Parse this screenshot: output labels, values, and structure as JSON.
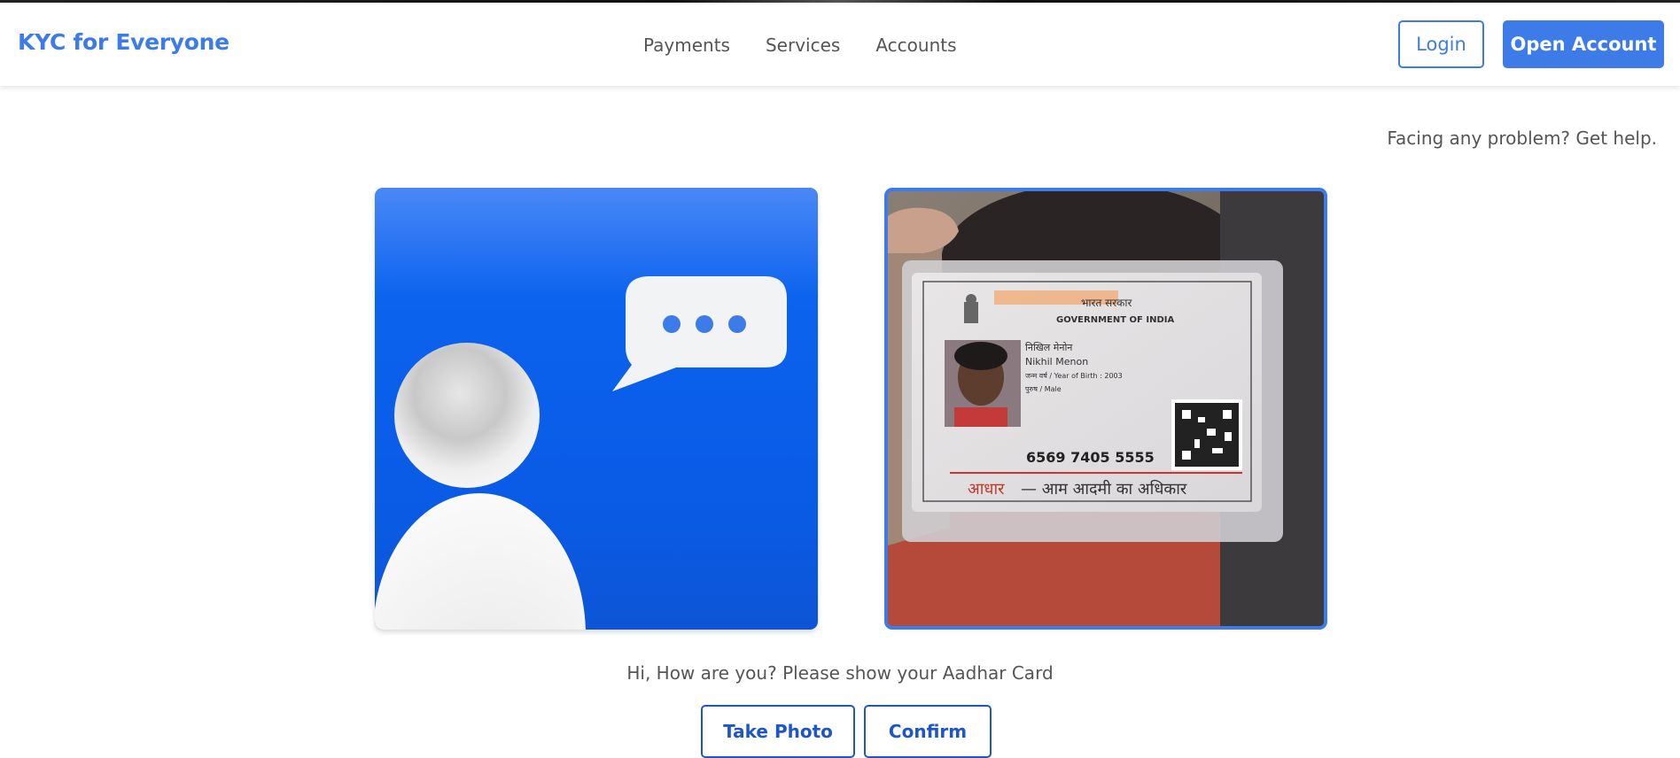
{
  "navbar": {
    "brand": "KYC for Everyone",
    "links": [
      "Payments",
      "Services",
      "Accounts"
    ],
    "login_label": "Login",
    "open_account_label": "Open Account"
  },
  "help_text": "Facing any problem? Get help.",
  "assistant_panel": {
    "icons": [
      "user-silhouette-icon",
      "chat-bubble-icon"
    ]
  },
  "camera_panel": {
    "card": {
      "header_hindi": "भारत सरकार",
      "header_english": "GOVERNMENT OF INDIA",
      "name_hindi": "निखिल मेनोन",
      "name_english": "Nikhil Menon",
      "year_of_birth_line": "जन्म वर्ष / Year of Birth : 2003",
      "gender_line": "पुरुष / Male",
      "number": "6569 7405 5555",
      "footer_hindi_red": "आधार",
      "footer_hindi_rest": "— आम आदमी का अधिकार"
    }
  },
  "message": "Hi, How are you? Please show your Aadhar Card",
  "actions": {
    "take_photo_label": "Take Photo",
    "confirm_label": "Confirm"
  },
  "colors": {
    "brand": "#3d7be8",
    "panel_blue": "#0b63ee",
    "button_outline": "#1f56c7"
  }
}
